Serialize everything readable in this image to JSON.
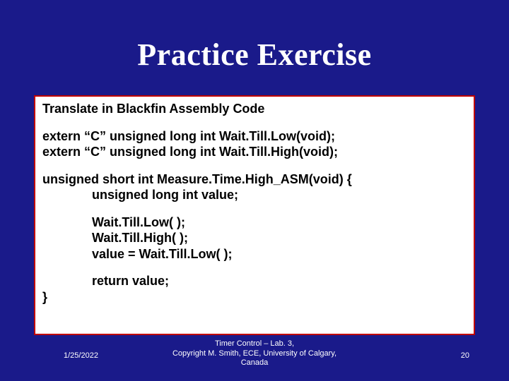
{
  "title": "Practice Exercise",
  "subheading": "Translate in Blackfin Assembly Code",
  "code": {
    "extern1": "extern “C” unsigned long int Wait.Till.Low(void);",
    "extern2": "extern “C” unsigned long int Wait.Till.High(void);",
    "fnDecl": "unsigned short int Measure.Time.High_ASM(void) {",
    "varDecl": "unsigned long int value;",
    "call1": "Wait.Till.Low( );",
    "call2": "Wait.Till.High( );",
    "assign": "value = Wait.Till.Low( );",
    "ret": "return value;",
    "close": "}"
  },
  "footer": {
    "date": "1/25/2022",
    "center_line1": "Timer Control – Lab. 3,",
    "center_line2": "Copyright M. Smith, ECE, University of Calgary,",
    "center_line3": "Canada",
    "page": "20"
  }
}
